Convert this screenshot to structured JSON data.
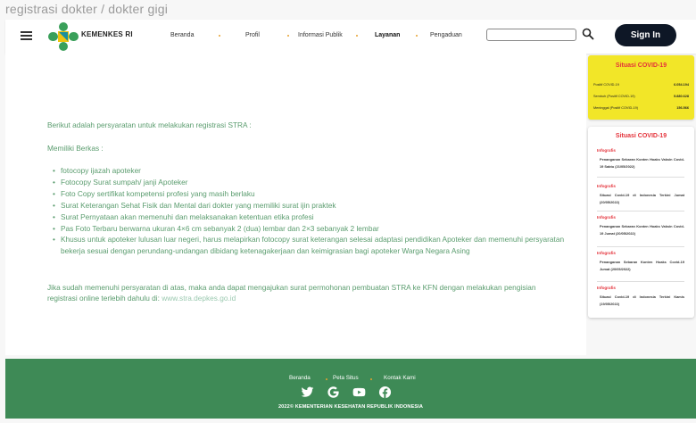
{
  "page_heading": "registrasi dokter / dokter gigi",
  "header": {
    "brand": "KEMENKES RI",
    "nav": [
      {
        "label": "Beranda"
      },
      {
        "label": "Profil"
      },
      {
        "label": "Informasi Publik"
      },
      {
        "label": "Layanan"
      },
      {
        "label": "Pengaduan"
      }
    ],
    "search": {
      "placeholder": "",
      "value": ""
    },
    "signin_label": "Sign In"
  },
  "main": {
    "intro": "Berikut adalah persyaratan untuk melakukan registrasi STRA :",
    "berkas": "Memiliki Berkas :",
    "requirements": [
      "fotocopy ijazah apoteker",
      "Fotocopy Surat sumpah/ janji Apoteker",
      "Foto Copy sertifikat kompetensi profesi yang masih berlaku",
      "Surat Keterangan Sehat Fisik dan Mental dari dokter yang memiliki surat ijin praktek",
      "Surat Pernyataan akan memenuhi dan melaksanakan ketentuan etika profesi",
      "Pas Foto Terbaru berwarna ukuran 4×6 cm sebanyak 2 (dua) lembar dan 2×3 sebanyak 2 lembar",
      "Khusus untuk apoteker lulusan luar negeri, harus melapirkan fotocopy surat keterangan selesai adaptasi pendidikan Apoteker dan memenuhi persyaratan bekerja sesuai dengan perundang-undangan dibidang ketenagakerjaan dan keimigrasian bagi apoteker Warga Negara Asing"
    ],
    "closing_text": "Jika sudah memenuhi persyaratan di atas, maka anda dapat mengajukan surat permohonan pembuatan STRA ke KFN dengan melakukan pengisian registrasi online terlebih dahulu di: ",
    "closing_link": "www.stra.depkes.go.id"
  },
  "sidebar": {
    "covid_stats": {
      "title": "Situasi COVID-19",
      "rows": [
        {
          "label": "Positif COVID-19",
          "value": "6.054.194"
        },
        {
          "label": "Sembuh (Positif COVID-19)",
          "value": "5.880.628"
        },
        {
          "label": "Meninggal (Positif COVID-19)",
          "value": "156.566"
        }
      ]
    },
    "news": {
      "title": "Situasi COVID-19",
      "items": [
        {
          "category": "Infografis",
          "text": "Penanganan Sebaran Konten Hoaks Vaksin Covid-19 Sabtu (21/05/2022)"
        },
        {
          "category": "Infografis",
          "text": "Situasi Covid-19 di Indonesia Terkini Jumat (20/05/2022)"
        },
        {
          "category": "Infografis",
          "text": "Penanganan Sebaran Konten Hoaks Vaksin Covid-19 Jumat (20/05/2022)"
        },
        {
          "category": "Infografis",
          "text": "Penanganan Sebaran Konten Hoaks Covid-19 Jumat (20/05/2022)"
        },
        {
          "category": "Infografis",
          "text": "Situasi Covid-19 di Indonesia Terkini Kamis (19/05/2022)"
        }
      ]
    }
  },
  "footer": {
    "links": [
      {
        "label": "Beranda"
      },
      {
        "label": "Peta Situs"
      },
      {
        "label": "Kontak Kami"
      }
    ],
    "social_icons": [
      "twitter-icon",
      "google-icon",
      "youtube-icon",
      "facebook-icon"
    ],
    "copyright": "2022© KEMENTERIAN KESEHATAN REPUBLIK INDONESIA"
  },
  "colors": {
    "accent_green": "#3e8a56",
    "text_green": "#5a9c6e",
    "alert_red": "#e4323a",
    "stats_yellow": "#f2e628",
    "button_dark": "#0e1726",
    "nav_dot": "#e8a22d"
  }
}
